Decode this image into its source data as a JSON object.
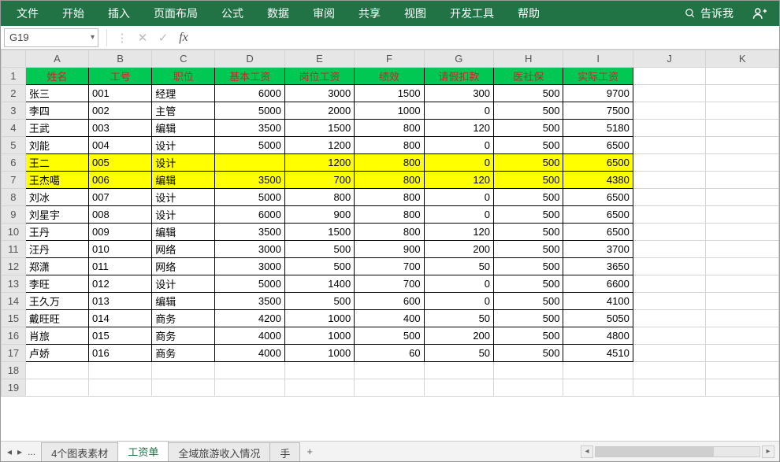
{
  "menu": {
    "tabs": [
      "文件",
      "开始",
      "插入",
      "页面布局",
      "公式",
      "数据",
      "审阅",
      "共享",
      "视图",
      "开发工具",
      "帮助"
    ],
    "tell_me": "告诉我"
  },
  "formula_bar": {
    "name_box": "G19",
    "formula": ""
  },
  "columns": [
    "A",
    "B",
    "C",
    "D",
    "E",
    "F",
    "G",
    "H",
    "I",
    "J",
    "K"
  ],
  "headers": [
    "姓名",
    "工号",
    "职位",
    "基本工资",
    "岗位工资",
    "绩效",
    "请假扣款",
    "医社保",
    "实际工资"
  ],
  "rows": [
    {
      "n": "张三",
      "id": "001",
      "pos": "经理",
      "base": "6000",
      "post": "3000",
      "perf": "1500",
      "leave": "300",
      "ins": "500",
      "net": "9700",
      "hl": false
    },
    {
      "n": "李四",
      "id": "002",
      "pos": "主管",
      "base": "5000",
      "post": "2000",
      "perf": "1000",
      "leave": "0",
      "ins": "500",
      "net": "7500",
      "hl": false
    },
    {
      "n": "王武",
      "id": "003",
      "pos": "编辑",
      "base": "3500",
      "post": "1500",
      "perf": "800",
      "leave": "120",
      "ins": "500",
      "net": "5180",
      "hl": false
    },
    {
      "n": "刘能",
      "id": "004",
      "pos": "设计",
      "base": "5000",
      "post": "1200",
      "perf": "800",
      "leave": "0",
      "ins": "500",
      "net": "6500",
      "hl": false
    },
    {
      "n": "王二",
      "id": "005",
      "pos": "设计",
      "base": "",
      "post": "1200",
      "perf": "800",
      "leave": "0",
      "ins": "500",
      "net": "6500",
      "hl": true
    },
    {
      "n": "王杰噶",
      "id": "006",
      "pos": "编辑",
      "base": "3500",
      "post": "700",
      "perf": "800",
      "leave": "120",
      "ins": "500",
      "net": "4380",
      "hl": true
    },
    {
      "n": "刘冰",
      "id": "007",
      "pos": "设计",
      "base": "5000",
      "post": "800",
      "perf": "800",
      "leave": "0",
      "ins": "500",
      "net": "6500",
      "hl": false
    },
    {
      "n": "刘星宇",
      "id": "008",
      "pos": "设计",
      "base": "6000",
      "post": "900",
      "perf": "800",
      "leave": "0",
      "ins": "500",
      "net": "6500",
      "hl": false
    },
    {
      "n": "王丹",
      "id": "009",
      "pos": "编辑",
      "base": "3500",
      "post": "1500",
      "perf": "800",
      "leave": "120",
      "ins": "500",
      "net": "6500",
      "hl": false
    },
    {
      "n": "汪丹",
      "id": "010",
      "pos": "网络",
      "base": "3000",
      "post": "500",
      "perf": "900",
      "leave": "200",
      "ins": "500",
      "net": "3700",
      "hl": false
    },
    {
      "n": "郑潇",
      "id": "011",
      "pos": "网络",
      "base": "3000",
      "post": "500",
      "perf": "700",
      "leave": "50",
      "ins": "500",
      "net": "3650",
      "hl": false
    },
    {
      "n": "李旺",
      "id": "012",
      "pos": "设计",
      "base": "5000",
      "post": "1400",
      "perf": "700",
      "leave": "0",
      "ins": "500",
      "net": "6600",
      "hl": false
    },
    {
      "n": "王久万",
      "id": "013",
      "pos": "编辑",
      "base": "3500",
      "post": "500",
      "perf": "600",
      "leave": "0",
      "ins": "500",
      "net": "4100",
      "hl": false
    },
    {
      "n": "戴旺旺",
      "id": "014",
      "pos": "商务",
      "base": "4200",
      "post": "1000",
      "perf": "400",
      "leave": "50",
      "ins": "500",
      "net": "5050",
      "hl": false
    },
    {
      "n": "肖旅",
      "id": "015",
      "pos": "商务",
      "base": "4000",
      "post": "1000",
      "perf": "500",
      "leave": "200",
      "ins": "500",
      "net": "4800",
      "hl": false
    },
    {
      "n": "卢娇",
      "id": "016",
      "pos": "商务",
      "base": "4000",
      "post": "1000",
      "perf": "60",
      "leave": "50",
      "ins": "500",
      "net": "4510",
      "hl": false
    }
  ],
  "empty_after": 19,
  "sheets": {
    "tabs": [
      "4个图表素材",
      "工资单",
      "全域旅游收入情况",
      "手"
    ],
    "active": 1,
    "nav_ellipsis": "...",
    "add_label": "+"
  }
}
